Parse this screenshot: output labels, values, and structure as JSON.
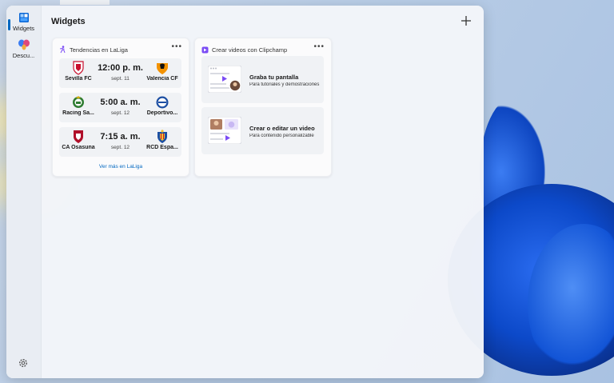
{
  "panel": {
    "title": "Widgets",
    "add_label": "+"
  },
  "nav": {
    "items": [
      {
        "label": "Widgets",
        "icon": "widgets-icon",
        "active": true
      },
      {
        "label": "Descu...",
        "icon": "discover-icon",
        "active": false
      }
    ],
    "settings_icon": "gear-icon"
  },
  "laliga": {
    "title": "Tendencias en LaLiga",
    "menu": "•••",
    "more_link": "Ver más en LaLiga",
    "matches": [
      {
        "home": "Sevilla FC",
        "away": "Valencia CF",
        "time": "12:00 p. m.",
        "date": "sept. 11",
        "home_color": "#c8102e",
        "away_color": "#f39200"
      },
      {
        "home": "Racing Sa...",
        "away": "Deportivo...",
        "time": "5:00 a. m.",
        "date": "sept. 12",
        "home_color": "#2f7d32",
        "away_color": "#1d4fa3"
      },
      {
        "home": "CA Osasuna",
        "away": "RCD Espa...",
        "time": "7:15 a. m.",
        "date": "sept. 12",
        "home_color": "#b0102a",
        "away_color": "#1d4fa3"
      }
    ]
  },
  "clipchamp": {
    "title": "Crear videos con Clipchamp",
    "menu": "•••",
    "items": [
      {
        "title": "Graba tu pantalla",
        "subtitle": "Para tutoriales y demostraciones"
      },
      {
        "title": "Crear o editar un video",
        "subtitle": "Para contenido personalizable"
      }
    ],
    "accent": "#7b4cf5"
  }
}
